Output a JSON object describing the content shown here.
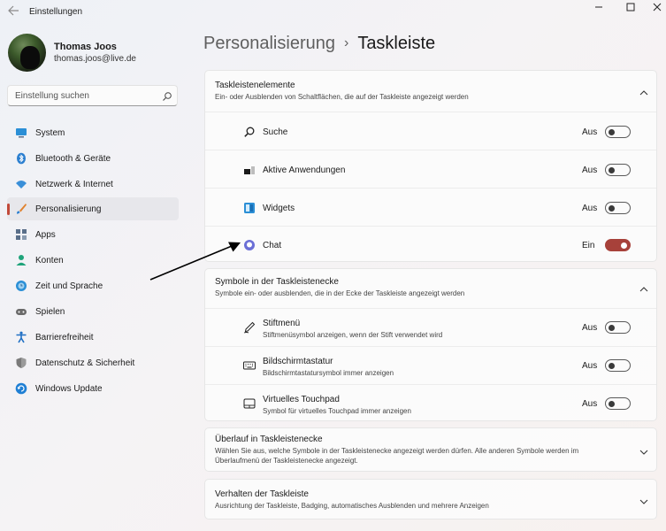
{
  "window": {
    "title": "Einstellungen"
  },
  "profile": {
    "name": "Thomas Joos",
    "email": "thomas.joos@live.de"
  },
  "search": {
    "placeholder": "Einstellung suchen"
  },
  "sidebar": {
    "items": [
      {
        "label": "System",
        "icon": "monitor-icon",
        "color": "#2b8fd6"
      },
      {
        "label": "Bluetooth & Geräte",
        "icon": "bluetooth-icon",
        "color": "#2b7fd0"
      },
      {
        "label": "Netzwerk & Internet",
        "icon": "wifi-icon",
        "color": "#3a8fd8"
      },
      {
        "label": "Personalisierung",
        "icon": "brush-icon",
        "color": "#e0822e"
      },
      {
        "label": "Apps",
        "icon": "apps-icon",
        "color": "#5a6f8a"
      },
      {
        "label": "Konten",
        "icon": "person-icon",
        "color": "#1fa37a"
      },
      {
        "label": "Zeit und Sprache",
        "icon": "globe-clock-icon",
        "color": "#2b8fd6"
      },
      {
        "label": "Spielen",
        "icon": "gamepad-icon",
        "color": "#6a6a6a"
      },
      {
        "label": "Barrierefreiheit",
        "icon": "accessibility-icon",
        "color": "#1f6fc4"
      },
      {
        "label": "Datenschutz & Sicherheit",
        "icon": "shield-icon",
        "color": "#7a7a7a"
      },
      {
        "label": "Windows Update",
        "icon": "update-icon",
        "color": "#1f7fd4"
      }
    ],
    "active_index": 3
  },
  "breadcrumb": {
    "parent": "Personalisierung",
    "separator": "›",
    "current": "Taskleiste"
  },
  "sections": {
    "taskbar_items": {
      "title": "Taskleistenelemente",
      "subtitle": "Ein- oder Ausblenden von Schaltflächen, die auf der Taskleiste angezeigt werden",
      "expanded": true,
      "rows": [
        {
          "label": "Suche",
          "icon": "search-icon",
          "state": "Aus",
          "on": false
        },
        {
          "label": "Aktive Anwendungen",
          "icon": "task-view-icon",
          "state": "Aus",
          "on": false
        },
        {
          "label": "Widgets",
          "icon": "widgets-icon",
          "state": "Aus",
          "on": false
        },
        {
          "label": "Chat",
          "icon": "chat-icon",
          "state": "Ein",
          "on": true
        }
      ]
    },
    "corner_icons": {
      "title": "Symbole in der Taskleistenecke",
      "subtitle": "Symbole ein- oder ausblenden, die in der Ecke der Taskleiste angezeigt werden",
      "expanded": true,
      "rows": [
        {
          "label": "Stiftmenü",
          "sub": "Stiftmenüsymbol anzeigen, wenn der Stift verwendet wird",
          "icon": "pen-icon",
          "state": "Aus",
          "on": false
        },
        {
          "label": "Bildschirmtastatur",
          "sub": "Bildschirmtastatursymbol immer anzeigen",
          "icon": "keyboard-icon",
          "state": "Aus",
          "on": false
        },
        {
          "label": "Virtuelles Touchpad",
          "sub": "Symbol für virtuelles Touchpad immer anzeigen",
          "icon": "touchpad-icon",
          "state": "Aus",
          "on": false
        }
      ]
    },
    "overflow": {
      "title": "Überlauf in Taskleistenecke",
      "subtitle_line1": "Wählen Sie aus, welche Symbole in der Taskleistenecke angezeigt werden dürfen. Alle anderen Symbole werden im",
      "subtitle_line2": "Überlaufmenü der Taskleistenecke angezeigt.",
      "expanded": false
    },
    "behavior": {
      "title": "Verhalten der Taskleiste",
      "subtitle": "Ausrichtung der Taskleiste, Badging, automatisches Ausblenden und mehrere Anzeigen",
      "expanded": false
    }
  },
  "colors": {
    "accent": "#a7413a",
    "indicator": "#c24a3a"
  }
}
